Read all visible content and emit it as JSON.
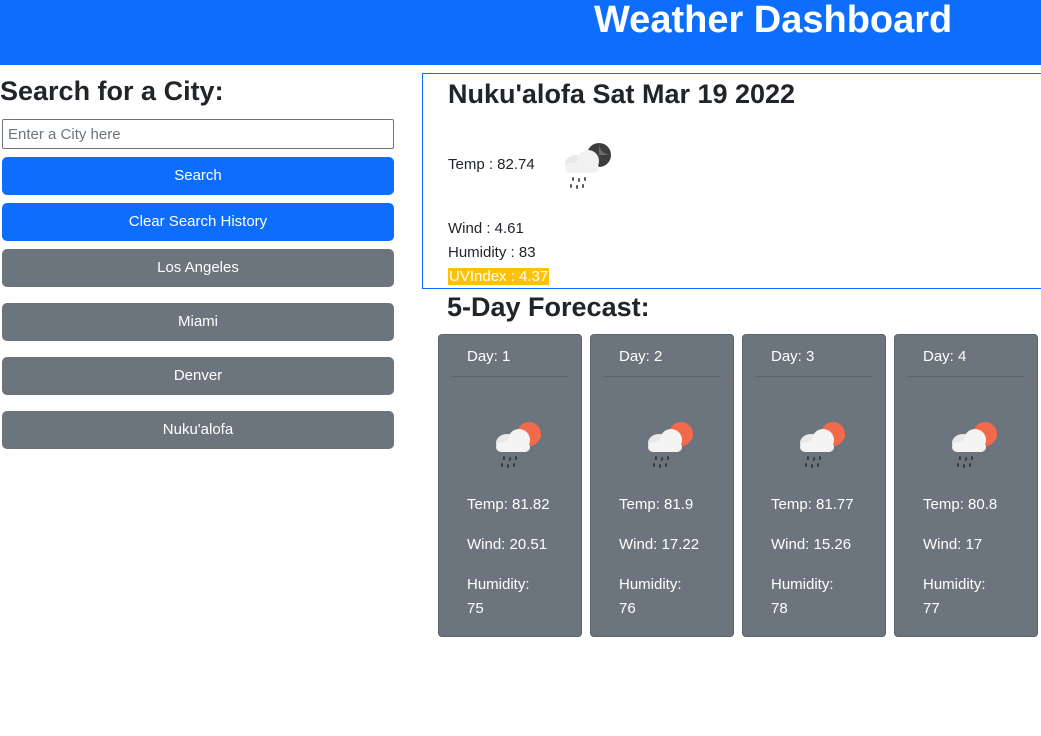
{
  "header": {
    "title": "Weather Dashboard"
  },
  "search": {
    "title": "Search for a City:",
    "input_value": "",
    "placeholder": "Enter a City here",
    "search_label": "Search",
    "clear_label": "Clear Search History"
  },
  "history": [
    {
      "label": "Los Angeles"
    },
    {
      "label": "Miami"
    },
    {
      "label": "Denver"
    },
    {
      "label": "Nuku'alofa"
    }
  ],
  "current": {
    "title": "Nuku'alofa Sat Mar 19 2022",
    "temp": "Temp : 82.74",
    "icon": "rain-night-icon",
    "wind": "Wind : 4.61",
    "humidity": "Humidity : 83",
    "uv": "UVIndex : 4.37",
    "uv_color": "#ffc107"
  },
  "forecast": {
    "title": "5-Day Forecast:",
    "days": [
      {
        "day": "Day: 1",
        "icon": "rain-sun-icon",
        "temp": "Temp: 81.82",
        "wind": "Wind: 20.51",
        "humidity_label": "Humidity:",
        "humidity_value": "75"
      },
      {
        "day": "Day: 2",
        "icon": "rain-sun-icon",
        "temp": "Temp: 81.9",
        "wind": "Wind: 17.22",
        "humidity_label": "Humidity:",
        "humidity_value": "76"
      },
      {
        "day": "Day: 3",
        "icon": "rain-sun-icon",
        "temp": "Temp: 81.77",
        "wind": "Wind: 15.26",
        "humidity_label": "Humidity:",
        "humidity_value": "78"
      },
      {
        "day": "Day: 4",
        "icon": "rain-sun-icon",
        "temp": "Temp: 80.8",
        "wind": "Wind: 17",
        "humidity_label": "Humidity:",
        "humidity_value": "77"
      }
    ]
  },
  "colors": {
    "primary": "#0d6efd",
    "secondary": "#6c757d",
    "uv_warning": "#ffc107"
  }
}
